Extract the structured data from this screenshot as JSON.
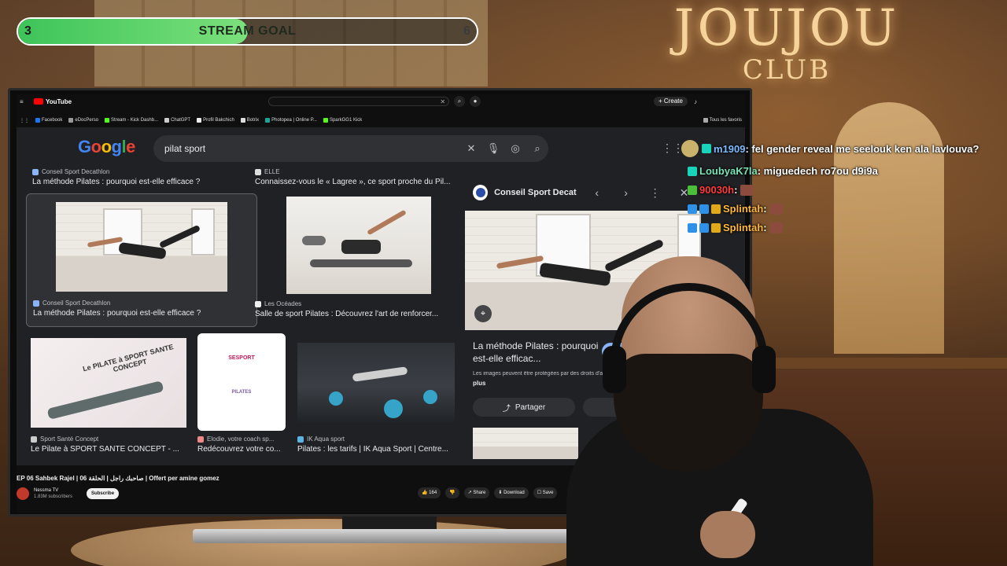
{
  "overlay": {
    "goal": {
      "start": "3",
      "label": "STREAM GOAL",
      "end": "6",
      "progress_fraction": 0.5
    },
    "brand": {
      "main": "JOUJOU",
      "sub": "CLUB"
    }
  },
  "youtube": {
    "logo": "YouTube",
    "create_label": "+ Create",
    "video_title": "EP 06 Sahbek Rajel | صاحبك راجل | الحلقة 06 | Offert per amine gomez",
    "channel": {
      "name": "Nessma TV",
      "subscribers": "1.83M subscribers",
      "subscribe_label": "Subscribe"
    },
    "actions": {
      "likes": "164",
      "share": "Share",
      "download": "Download",
      "save": "Save"
    }
  },
  "bookmarks": {
    "items": [
      "Facebook",
      "eDocPerso",
      "Stream - Kick Dashb...",
      "ChatGPT",
      "Profil Bakchich",
      "Botrix",
      "Photopea | Online P...",
      "SparkGG1 Kick"
    ],
    "all_label": "Tous les favoris"
  },
  "google": {
    "logo": "Google",
    "query": "pilat sport",
    "results": [
      {
        "source": "Conseil Sport Decathlon",
        "title": "La méthode Pilates : pourquoi est-elle efficace ?"
      },
      {
        "source": "ELLE",
        "title": "Connaissez-vous le « Lagree », ce sport proche du Pil..."
      },
      {
        "source": "Conseil Sport Decathlon",
        "title": "La méthode Pilates : pourquoi est-elle efficace ?"
      },
      {
        "source": "Les Océades",
        "title": "Salle de sport Pilates : Découvrez l'art de renforcer..."
      },
      {
        "source": "Sport Santé Concept",
        "title": "Le Pilate à SPORT SANTE CONCEPT - ..."
      },
      {
        "source": "Elodie, votre coach sp...",
        "title": "Redécouvrez votre co..."
      },
      {
        "source": "IK Aqua sport",
        "title": "Pilates : les tarifs | IK Aqua Sport | Centre..."
      }
    ],
    "thumb_texts": {
      "concept": "Le PILATE à SPORT SANTE CONCEPT",
      "poster_brand": "SESPORT",
      "poster_title": "PILATES"
    },
    "panel": {
      "source": "Conseil Sport Decathlon",
      "title": "La méthode Pilates : pourquoi est-elle efficac...",
      "visit_label": "A",
      "note": "Les images peuvent être protégées par des droits d'a...",
      "more": "plus",
      "share": "Partager"
    }
  },
  "chat": [
    {
      "user": "m1909",
      "text": ": fel gender reveal me seelouk ken ala lavlouva?",
      "color": "#7dbbff"
    },
    {
      "user": "LoubyaK7la",
      "text": ": miguedech ro7ou d9i9a",
      "color": "#7de3b8"
    },
    {
      "user": "90030h",
      "text": ":",
      "color": "#ff3b3b"
    },
    {
      "user": "Splintah",
      "text": ":",
      "color": "#ffb938"
    },
    {
      "user": "Splintah",
      "text": ":",
      "color": "#ffb938"
    }
  ],
  "colors": {
    "goal_fill": "#3ec45a",
    "google_bg": "#202124",
    "yt_red": "#ff0000"
  }
}
